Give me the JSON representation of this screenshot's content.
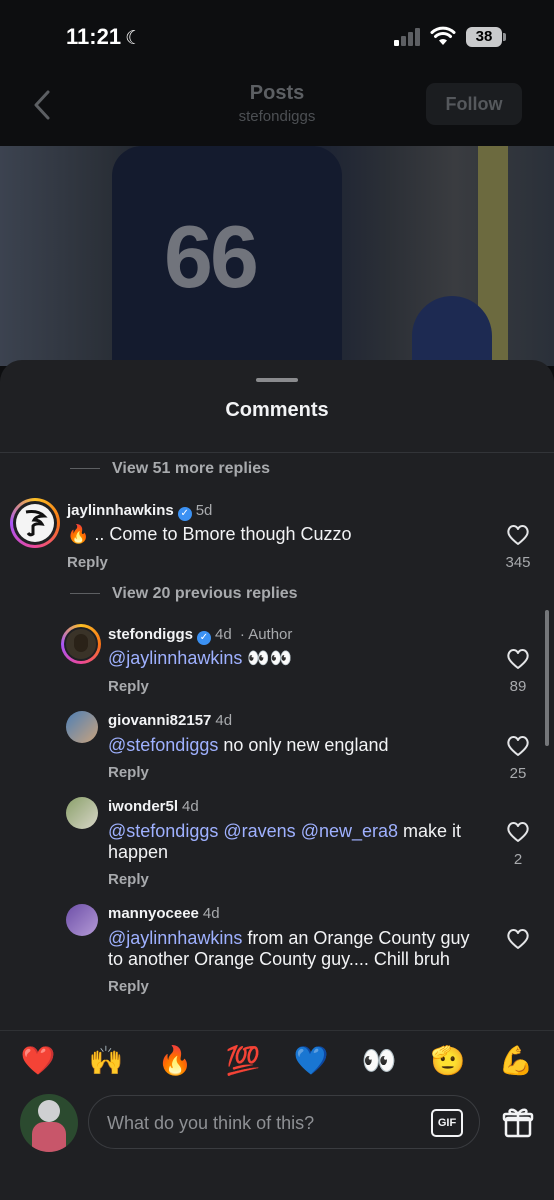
{
  "status_bar": {
    "time": "11:21",
    "battery": "38"
  },
  "header": {
    "title": "Posts",
    "subtitle": "stefondiggs",
    "follow_label": "Follow"
  },
  "photo": {
    "jersey_number": "66"
  },
  "sheet": {
    "title": "Comments"
  },
  "thread": {
    "view_more_replies": "View 51 more replies",
    "view_previous_replies": "View 20 previous replies",
    "reply_label": "Reply"
  },
  "comments": [
    {
      "username": "jaylinnhawkins",
      "verified": true,
      "time": "5d",
      "emoji": "🔥",
      "text": " .. Come to Bmore though Cuzzo",
      "likes": "345"
    },
    {
      "username": "stefondiggs",
      "verified": true,
      "time": "4d",
      "author_label": "Author",
      "mention": "@jaylinnhawkins",
      "text": " 👀👀",
      "likes": "89"
    },
    {
      "username": "giovanni82157",
      "time": "4d",
      "mention": "@stefondiggs",
      "text": " no only new england",
      "likes": "25"
    },
    {
      "username": "iwonder5l",
      "time": "4d",
      "mentions": [
        "@stefondiggs",
        "@ravens",
        "@new_era8"
      ],
      "text_line1": " make it",
      "text_line2": "happen",
      "likes": "2"
    },
    {
      "username": "mannyoceee",
      "time": "4d",
      "mention": "@jaylinnhawkins",
      "text_line1": " from an Orange County guy",
      "text_line2": "to another Orange County guy.... Chill bruh"
    }
  ],
  "quick_emojis": [
    "❤️",
    "🙌",
    "🔥",
    "💯",
    "💙",
    "👀",
    "🫡",
    "💪"
  ],
  "composer": {
    "placeholder": "What do you think of this?",
    "gif_label": "GIF"
  },
  "colors": {
    "background": "#0d0e10",
    "sheet": "#1f2023",
    "mention": "#9fb1ff",
    "verified": "#3b91f3"
  }
}
